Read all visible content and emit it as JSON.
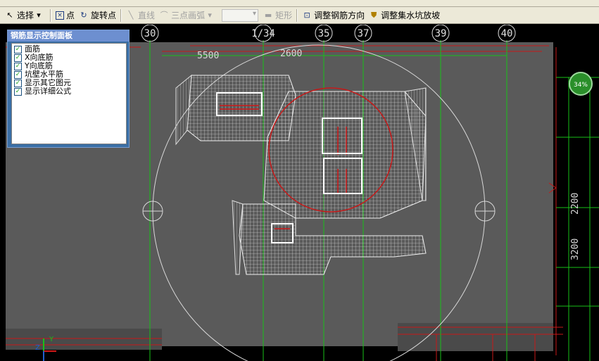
{
  "toolbar": {
    "select_label": "选择",
    "point_label": "点",
    "rotate_point_label": "旋转点",
    "line_label": "直线",
    "arc_label": "三点画弧",
    "rect_label": "矩形",
    "adjust_rebar_label": "调整钢筋方向",
    "adjust_pit_label": "调整集水坑放坡"
  },
  "panel": {
    "title": "钢筋显示控制面板",
    "items": [
      {
        "label": "面筋",
        "checked": true
      },
      {
        "label": "X向底筋",
        "checked": true
      },
      {
        "label": "Y向底筋",
        "checked": true
      },
      {
        "label": "坑壁水平筋",
        "checked": true
      },
      {
        "label": "显示其它图元",
        "checked": true
      },
      {
        "label": "显示详细公式",
        "checked": true
      }
    ]
  },
  "axis_labels_top": [
    "30",
    "1/34",
    "35",
    "37",
    "39",
    "40"
  ],
  "dims_top": [
    "5500",
    "2600"
  ],
  "dims_right": [
    "2200",
    "3200"
  ],
  "progress_percent": "34%",
  "colors": {
    "background": "#000000",
    "plate": "#5a5a5a",
    "axis_green": "#18c018",
    "rebar_red": "#d01818"
  }
}
